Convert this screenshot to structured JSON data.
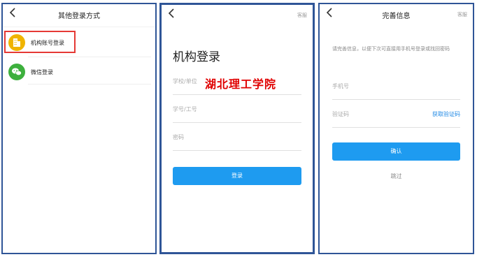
{
  "panel1": {
    "title": "其他登录方式",
    "options": [
      {
        "label": "机构账号登录",
        "icon": "building-icon"
      },
      {
        "label": "微信登录",
        "icon": "wechat-icon"
      }
    ]
  },
  "panel2": {
    "support": "客服",
    "heading": "机构登录",
    "school_placeholder": "学校/单位",
    "school_value_overlay": "湖北理工学院",
    "id_placeholder": "学号/工号",
    "password_placeholder": "密码",
    "login_button": "登录"
  },
  "panel3": {
    "title": "完善信息",
    "support": "客服",
    "description": "请完善信息，以便下次可直接用手机号登录或找回密码",
    "phone_placeholder": "手机号",
    "code_placeholder": "验证码",
    "get_code": "获取验证码",
    "confirm_button": "确认",
    "skip": "跳过"
  },
  "colors": {
    "border": "#2f5597",
    "primary": "#1e9bf0",
    "highlight": "#e53935",
    "overlay_text": "#e00000",
    "wechat": "#3db03d",
    "building": "#f0b400"
  }
}
